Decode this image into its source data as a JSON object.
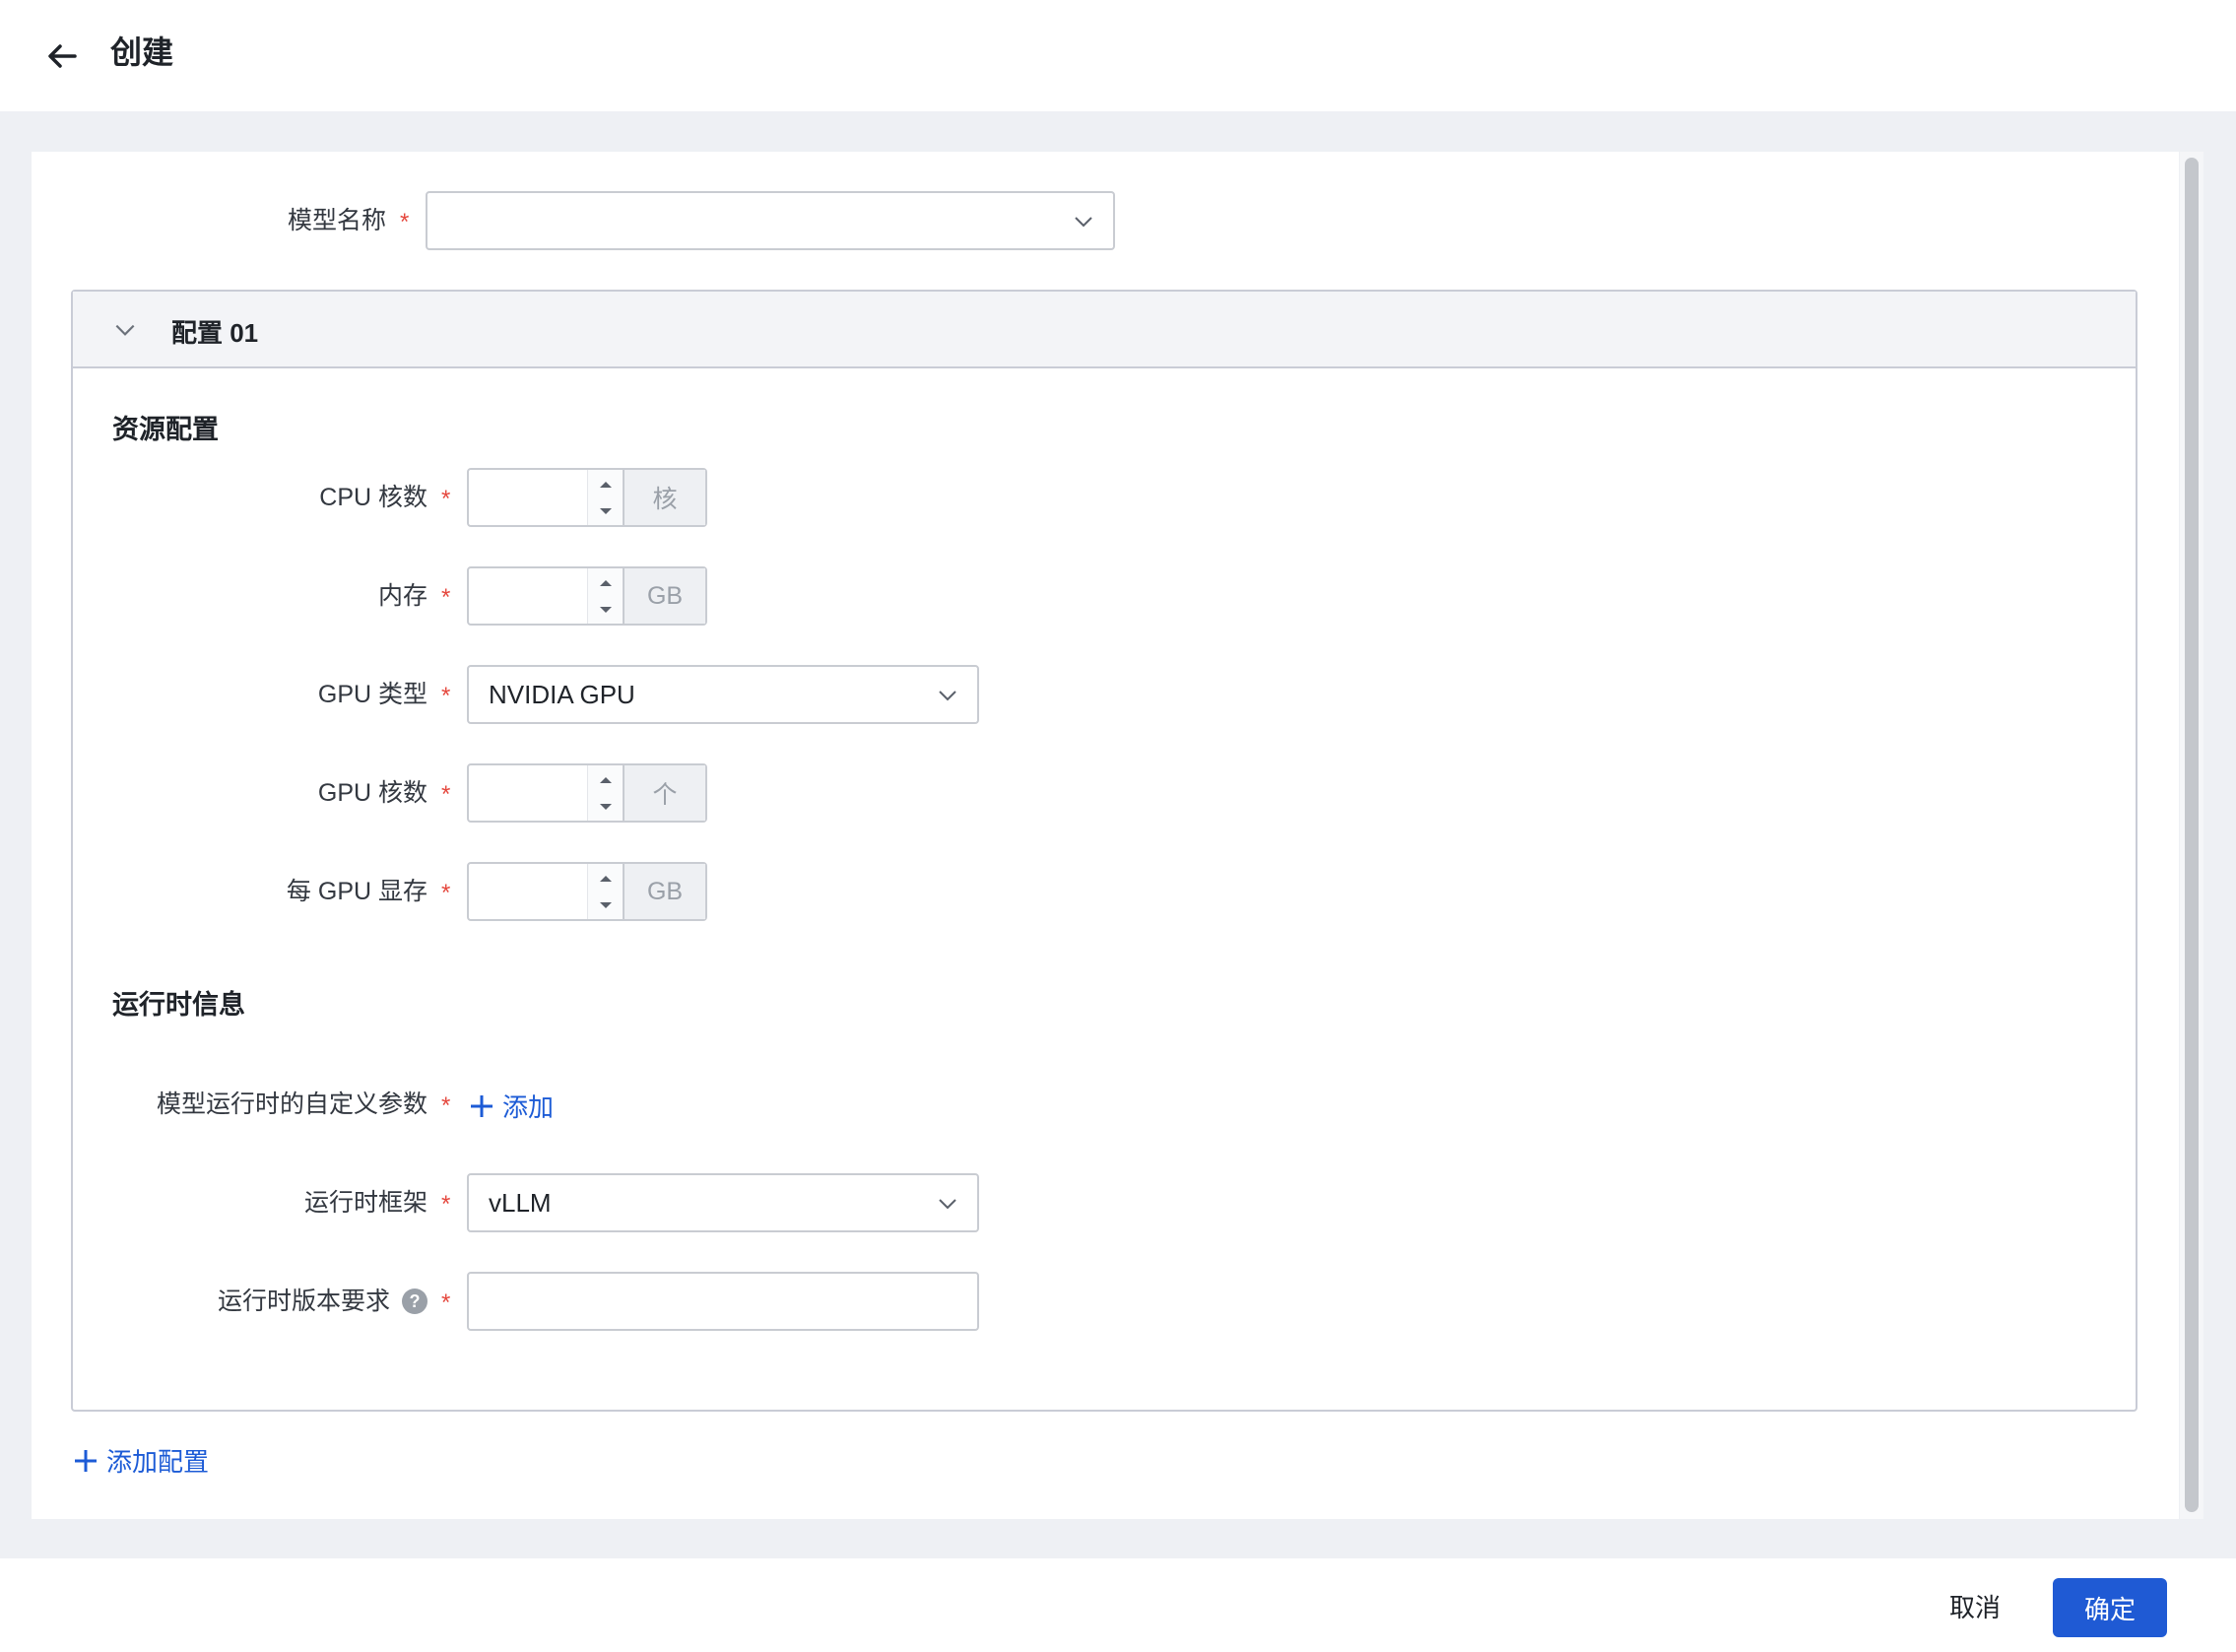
{
  "header": {
    "title": "创建",
    "back_icon": "arrow-left-icon"
  },
  "form": {
    "model_name": {
      "label": "模型名称",
      "value": ""
    },
    "config": {
      "title": "配置 01",
      "resource_section": "资源配置",
      "cpu": {
        "label": "CPU 核数",
        "unit": "核",
        "value": ""
      },
      "memory": {
        "label": "内存",
        "unit": "GB",
        "value": ""
      },
      "gpu_type": {
        "label": "GPU 类型",
        "value": "NVIDIA GPU"
      },
      "gpu_cores": {
        "label": "GPU 核数",
        "unit": "个",
        "value": ""
      },
      "gpu_memory": {
        "label": "每 GPU 显存",
        "unit": "GB",
        "value": ""
      },
      "runtime_section": "运行时信息",
      "custom_params": {
        "label": "模型运行时的自定义参数",
        "add_label": "添加"
      },
      "runtime_framework": {
        "label": "运行时框架",
        "value": "vLLM"
      },
      "runtime_version": {
        "label": "运行时版本要求",
        "value": ""
      }
    },
    "add_config_label": "添加配置"
  },
  "footer": {
    "cancel_label": "取消",
    "ok_label": "确定"
  },
  "colors": {
    "primary": "#1f5ad4",
    "required": "#e5483e"
  }
}
